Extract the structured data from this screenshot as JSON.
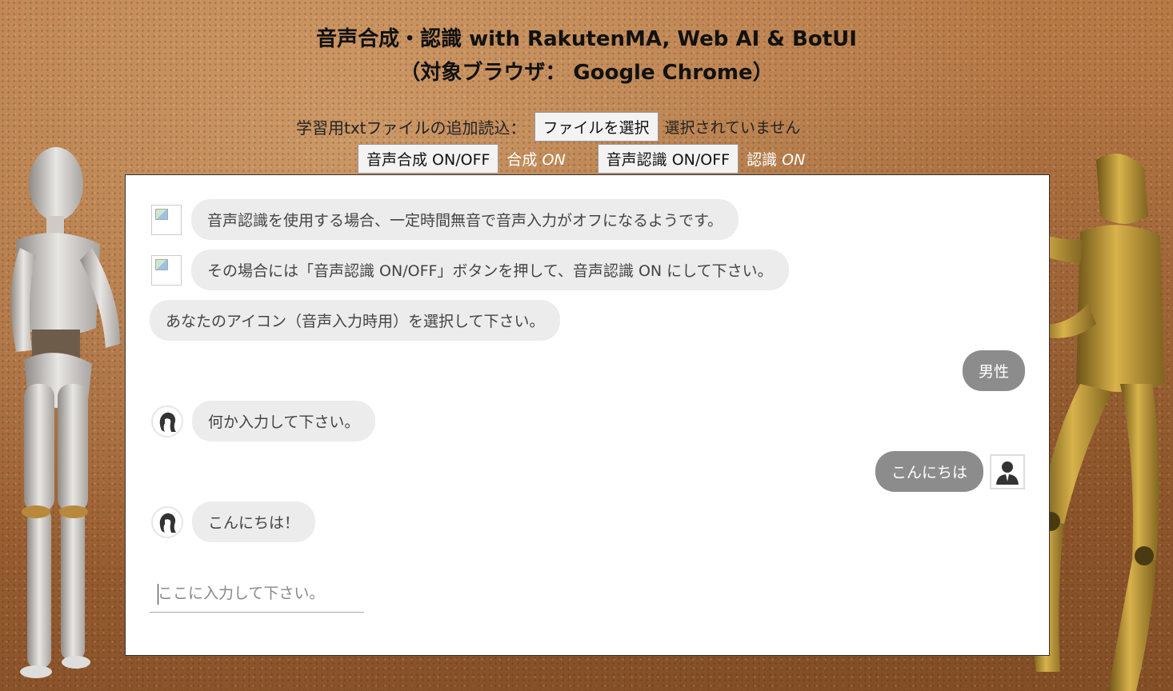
{
  "title": {
    "line1": "音声合成・認識 with RakutenMA, Web AI & BotUI",
    "line2": "（対象ブラウザ： Google Chrome）"
  },
  "file_upload": {
    "label": "学習用txtファイルの追加読込：",
    "button": "ファイルを選択",
    "status": "選択されていません"
  },
  "toggles": {
    "synthesis_button": "音声合成 ON/OFF",
    "synthesis_label": "合成",
    "synthesis_state": "ON",
    "recognition_button": "音声認識 ON/OFF",
    "recognition_label": "認識",
    "recognition_state": "ON"
  },
  "messages": [
    {
      "sender": "bot",
      "avatar": "broken-image",
      "text": "音声認識を使用する場合、一定時間無音で音声入力がオフになるようです。"
    },
    {
      "sender": "bot",
      "avatar": "broken-image",
      "text": "その場合には「音声認識 ON/OFF」ボタンを押して、音声認識 ON にして下さい。"
    },
    {
      "sender": "bot",
      "avatar": "none",
      "text": "あなたのアイコン（音声入力時用）を選択して下さい。"
    },
    {
      "sender": "human",
      "avatar": "none",
      "text": "男性"
    },
    {
      "sender": "bot",
      "avatar": "female-icon",
      "text": "何か入力して下さい。"
    },
    {
      "sender": "human",
      "avatar": "male-icon",
      "text": "こんにちは"
    },
    {
      "sender": "bot",
      "avatar": "female-icon",
      "text": "こんにちは！"
    }
  ],
  "chat_input": {
    "placeholder": "ここに入力して下さい。",
    "value": ""
  },
  "colors": {
    "bot_bubble": "#ececec",
    "human_bubble": "#8c8c8c",
    "background": "#a96d3d"
  }
}
